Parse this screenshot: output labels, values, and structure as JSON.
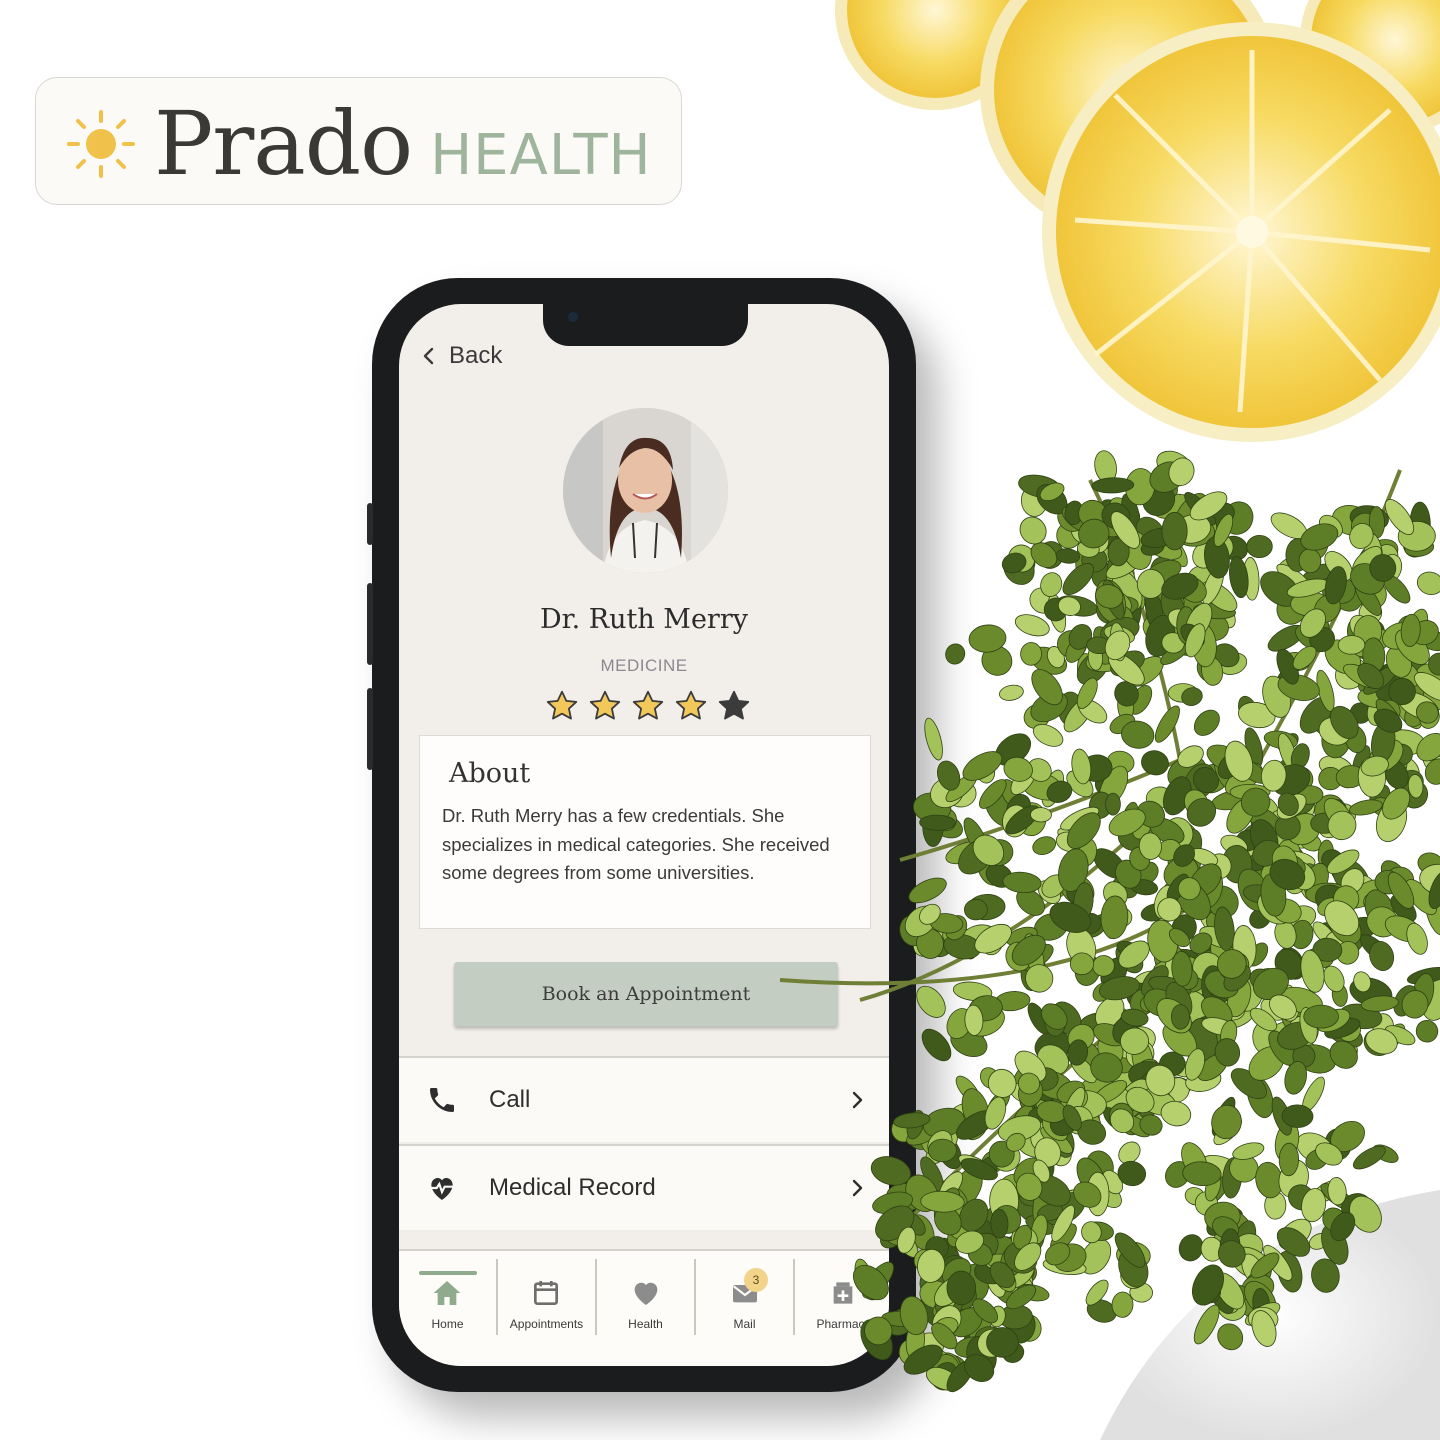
{
  "brand": {
    "name": "Prado",
    "tagline": "HEALTH",
    "accent_color": "#f1c24b",
    "tagline_color": "#9fb49d",
    "logo_icon": "sun-icon"
  },
  "screen": {
    "back_label": "Back",
    "doctor": {
      "name": "Dr. Ruth Merry",
      "specialty": "MEDICINE",
      "rating": 4,
      "rating_max": 5
    },
    "about": {
      "title": "About",
      "text": "Dr. Ruth Merry has a few credentials. She specializes in medical categories. She received some degrees from some universities."
    },
    "book_button": "Book an Appointment",
    "actions": [
      {
        "label": "Call",
        "icon": "phone-icon"
      },
      {
        "label": "Medical Record",
        "icon": "heart-pulse-icon"
      }
    ],
    "tabs": [
      {
        "label": "Home",
        "icon": "home-icon",
        "active": true
      },
      {
        "label": "Appointments",
        "icon": "calendar-icon"
      },
      {
        "label": "Health",
        "icon": "heart-icon"
      },
      {
        "label": "Mail",
        "icon": "mail-icon",
        "badge": "3"
      },
      {
        "label": "Pharmacy",
        "icon": "pharmacy-icon"
      }
    ]
  },
  "colors": {
    "screen_bg": "#f2eeea",
    "button_bg": "#c4cdc1",
    "star_fill": "#f3c85a",
    "active_tab": "#8faa8c"
  }
}
